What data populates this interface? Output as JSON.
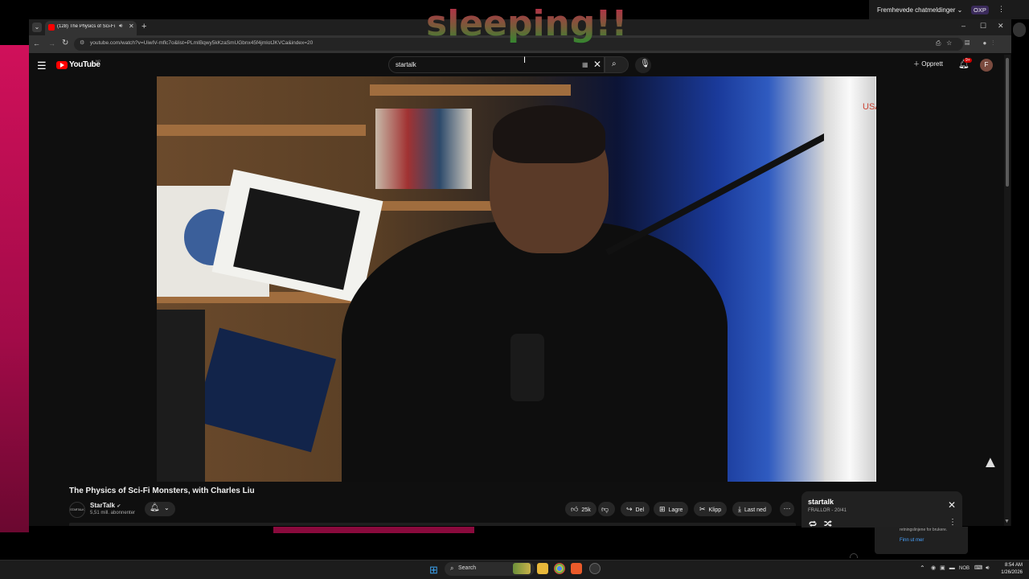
{
  "overlay": {
    "text": "sleeping!!"
  },
  "chat_dropdown": {
    "label": "Fremhevede chatmeldinger",
    "badge": "OXP"
  },
  "browser": {
    "tab_title": "(128) The Physics of Sci-Fi",
    "url": "youtube.com/watch?v=UiwIV-mflc7o&list=PLmIBqwy5kKzaSmUGbnx45f4jmlotJKVCa&index=20"
  },
  "youtube": {
    "logo_text": "YouTube",
    "logo_region": "NO",
    "search_value": "startalk",
    "create_label": "Opprett",
    "notification_count": "9+",
    "avatar_letter": "F"
  },
  "video": {
    "title": "The Physics of Sci-Fi Monsters, with Charles Liu",
    "rocket_text": "USA",
    "channel": {
      "avatar_text": "STARTALK",
      "name": "StarTalk",
      "subscribers": "5,51 mill. abonnenter"
    },
    "actions": {
      "likes": "25k",
      "share": "Del",
      "save": "Lagre",
      "clip": "Klipp",
      "download": "Last ned"
    }
  },
  "playlist": {
    "title": "startalk",
    "subtitle": "FRALLOR - 20/41"
  },
  "notification": {
    "text": "retningslinjene for brukere.",
    "link": "Finn ut mer"
  },
  "taskbar": {
    "search_label": "Search",
    "lang": "NOB",
    "time": "8:54 AM",
    "date": "1/26/2026"
  }
}
